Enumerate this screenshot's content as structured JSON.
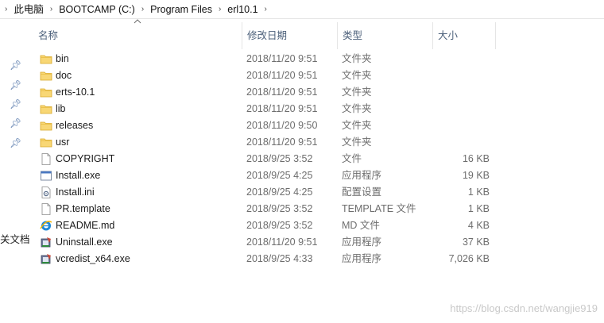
{
  "breadcrumb": {
    "items": [
      "此电脑",
      "BOOTCAMP (C:)",
      "Program Files",
      "erl10.1"
    ]
  },
  "nav": {
    "fragment_label": "关文档"
  },
  "columns": {
    "name": "名称",
    "date": "修改日期",
    "type": "类型",
    "size": "大小"
  },
  "files": [
    {
      "name": "bin",
      "date": "2018/11/20 9:51",
      "type": "文件夹",
      "size": "",
      "icon": "folder-icon"
    },
    {
      "name": "doc",
      "date": "2018/11/20 9:51",
      "type": "文件夹",
      "size": "",
      "icon": "folder-icon"
    },
    {
      "name": "erts-10.1",
      "date": "2018/11/20 9:51",
      "type": "文件夹",
      "size": "",
      "icon": "folder-icon"
    },
    {
      "name": "lib",
      "date": "2018/11/20 9:51",
      "type": "文件夹",
      "size": "",
      "icon": "folder-icon"
    },
    {
      "name": "releases",
      "date": "2018/11/20 9:50",
      "type": "文件夹",
      "size": "",
      "icon": "folder-icon"
    },
    {
      "name": "usr",
      "date": "2018/11/20 9:51",
      "type": "文件夹",
      "size": "",
      "icon": "folder-icon"
    },
    {
      "name": "COPYRIGHT",
      "date": "2018/9/25 3:52",
      "type": "文件",
      "size": "16 KB",
      "icon": "blank-file-icon"
    },
    {
      "name": "Install.exe",
      "date": "2018/9/25 4:25",
      "type": "应用程序",
      "size": "19 KB",
      "icon": "exe-file-icon"
    },
    {
      "name": "Install.ini",
      "date": "2018/9/25 4:25",
      "type": "配置设置",
      "size": "1 KB",
      "icon": "settings-file-icon"
    },
    {
      "name": "PR.template",
      "date": "2018/9/25 3:52",
      "type": "TEMPLATE 文件",
      "size": "1 KB",
      "icon": "blank-file-icon"
    },
    {
      "name": "README.md",
      "date": "2018/9/25 3:52",
      "type": "MD 文件",
      "size": "4 KB",
      "icon": "ie-file-icon"
    },
    {
      "name": "Uninstall.exe",
      "date": "2018/11/20 9:51",
      "type": "应用程序",
      "size": "37 KB",
      "icon": "installer-icon"
    },
    {
      "name": "vcredist_x64.exe",
      "date": "2018/9/25 4:33",
      "type": "应用程序",
      "size": "7,026 KB",
      "icon": "installer-icon"
    }
  ],
  "watermark": "https://blog.csdn.net/wangjie919"
}
